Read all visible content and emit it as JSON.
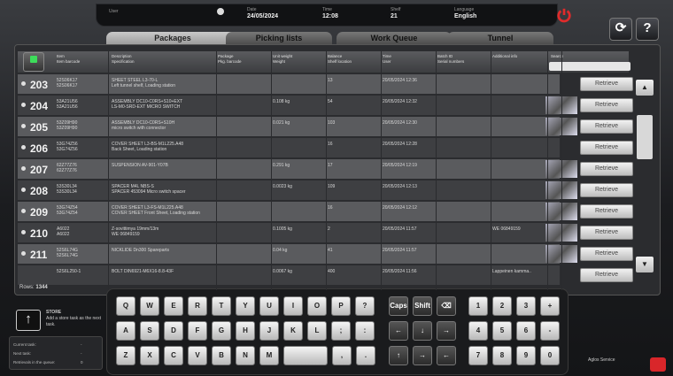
{
  "topbar": {
    "user_label": "User",
    "date_label": "Date",
    "date": "24/05/2024",
    "time_label": "Time",
    "time": "12:08",
    "shelf_label": "Shelf",
    "shelf": "21",
    "language_label": "Language",
    "language": "English"
  },
  "tabs": [
    "Packages",
    "Picking lists",
    "Work Queue",
    "Tunnel"
  ],
  "headers": {
    "c1": "Item\nItem barcode",
    "c2": "Description\nSpecification",
    "c3": "Package\nPkg. barcode",
    "c4": "Unit weight\nWeight",
    "c5": "Balance\nShelf location",
    "c6": "Time\nUser",
    "c7": "Batch ID\nSerial numbers",
    "c8": "Additional info",
    "search": "Search"
  },
  "rows": [
    {
      "num": "203",
      "item": "52S06K17\n52S06K17",
      "desc": "SHEET STEEL L3-70-L\nLeft tunnel shelf, Loading station",
      "weight": "",
      "bal": "13",
      "time": "20/05/2024 12:36",
      "info": "",
      "thumb": false
    },
    {
      "num": "204",
      "item": "53A21U56\n53A21U56",
      "desc": "ASSEMBLY DC10-C0RS+S10+EXT\nLS-M0-SRD-EXT MICRO SWITCH",
      "weight": "0.108 kg",
      "bal": "54",
      "time": "20/05/2024 12:32",
      "info": "",
      "thumb": true
    },
    {
      "num": "205",
      "item": "53Z09H90\n53Z09H90",
      "desc": "ASSEMBLY DC10-C0RS+S10H\nmicro switch with connector",
      "weight": "0.021 kg",
      "bal": "103",
      "time": "20/05/2024 12:30",
      "info": "",
      "thumb": true
    },
    {
      "num": "206",
      "item": "53G74Z56\n53G74Z56",
      "desc": "COVER SHEET L3-BS-M1L225.A48\nBack Sheet, Loading station",
      "weight": "",
      "bal": "16",
      "time": "20/05/2024 12:28",
      "info": "",
      "thumb": false
    },
    {
      "num": "207",
      "item": "62Z77Z76\n62Z77Z76",
      "desc": "SUSPENSION AV-901-Y07B",
      "weight": "0.291 kg",
      "bal": "17",
      "time": "20/05/2024 12:19",
      "info": "",
      "thumb": true
    },
    {
      "num": "208",
      "item": "53S30L34\n53S30L34",
      "desc": "SPACER M4L NBS-S\nSPACER 453094 Micro switch spacer",
      "weight": "0.0023 kg",
      "bal": "109",
      "time": "20/05/2024 12:13",
      "info": "",
      "thumb": true
    },
    {
      "num": "209",
      "item": "53G74Z54\n53G74Z54",
      "desc": "COVER SHEET L3-FS-M1L225.A48\nCOVER SHEET Front Sheet, Loading station",
      "weight": "",
      "bal": "16",
      "time": "20/05/2024 12:12",
      "info": "",
      "thumb": true
    },
    {
      "num": "210",
      "item": "A6022\nA6022",
      "desc": "Z-sovittimya 19mm/13m\nWE 06849159",
      "weight": "0.1005 kg",
      "bal": "2",
      "time": "20/05/2024 11:57",
      "info": "WE 06849159",
      "thumb": true
    },
    {
      "num": "211",
      "item": "52S6L74G\n52S6L74G",
      "desc": "NICKLIDE Dn300 Spareparts",
      "weight": "0.04 kg",
      "bal": "41",
      "time": "20/05/2024 11:57",
      "info": "",
      "thumb": true
    },
    {
      "num": "",
      "item": "52S6L250-1",
      "desc": "BOLT DIN6921-M6X16-8.8-43F",
      "weight": "0.0067 kg",
      "bal": "400",
      "time": "20/05/2024 11:56",
      "info": "Lappeinen kamma..",
      "thumb": false
    }
  ],
  "retrieve_label": "Retrieve",
  "rows_label": "Rows",
  "rows_count": "1344",
  "store": {
    "title": "STORE",
    "desc": "Add a store task as the next task."
  },
  "stats": {
    "current": "Current task:",
    "current_v": "-",
    "next": "Next task:",
    "next_v": "-",
    "queue": "Retrievals in the queue:",
    "queue_v": "0"
  },
  "keys": {
    "row1": [
      "Q",
      "W",
      "E",
      "R",
      "T",
      "Y",
      "U",
      "I",
      "O",
      "P",
      "?"
    ],
    "row2": [
      "A",
      "S",
      "D",
      "F",
      "G",
      "H",
      "J",
      "K",
      "L",
      ";",
      ":"
    ],
    "row3": [
      "Z",
      "X",
      "C",
      "V",
      "B",
      "N",
      "M",
      "",
      ",",
      "."
    ],
    "special": [
      "Caps",
      "Shift",
      "⌫"
    ],
    "nums": [
      "1",
      "2",
      "3",
      "+",
      "4",
      "5",
      "6",
      "-",
      "7",
      "8",
      "9",
      "0"
    ]
  },
  "brand": "Aglos Service"
}
